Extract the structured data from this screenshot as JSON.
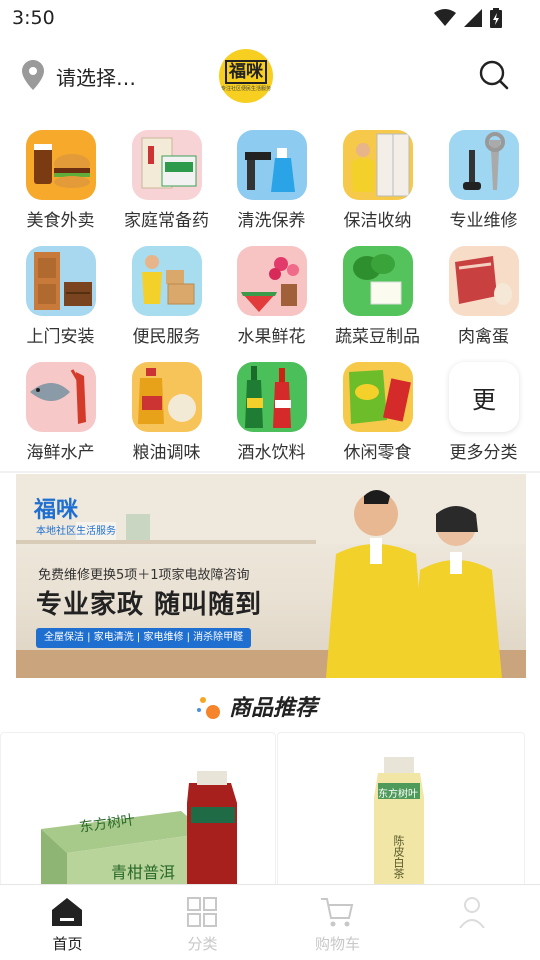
{
  "status_bar": {
    "time": "3:50"
  },
  "header": {
    "location": "请选择…",
    "logo_text": "福咪",
    "logo_subtext": "专注社区便民生活服务"
  },
  "categories": [
    {
      "label": "美食外卖",
      "icon": "burger-drink-icon"
    },
    {
      "label": "家庭常备药",
      "icon": "medicine-box-icon"
    },
    {
      "label": "清洗保养",
      "icon": "spray-bottle-icon"
    },
    {
      "label": "保洁收纳",
      "icon": "cleaner-wardrobe-icon"
    },
    {
      "label": "专业维修",
      "icon": "wrench-icon"
    },
    {
      "label": "上门安装",
      "icon": "door-cabinet-icon"
    },
    {
      "label": "便民服务",
      "icon": "delivery-boxes-icon"
    },
    {
      "label": "水果鲜花",
      "icon": "fruit-flower-icon"
    },
    {
      "label": "蔬菜豆制品",
      "icon": "vegetable-tofu-icon"
    },
    {
      "label": "肉禽蛋",
      "icon": "meat-egg-icon"
    },
    {
      "label": "海鲜水产",
      "icon": "fish-lobster-icon"
    },
    {
      "label": "粮油调味",
      "icon": "oil-rice-icon"
    },
    {
      "label": "酒水饮料",
      "icon": "bottles-icon"
    },
    {
      "label": "休闲零食",
      "icon": "snack-bag-icon"
    },
    {
      "label": "更多分类",
      "icon": "more-icon",
      "glyph": "更"
    }
  ],
  "banner": {
    "brand": "福咪",
    "brand_sub": "本地社区生活服务",
    "promo": "免费维修更换5项＋1项家电故障咨询",
    "headline": "专业家政 随叫随到",
    "tags": "全屋保洁 | 家电清洗 | 家电维修 | 消杀除甲醛"
  },
  "section": {
    "title": "商品推荐"
  },
  "products": [
    {
      "brand": "东方树叶",
      "flavor": "青柑普洱"
    },
    {
      "brand": "东方树叶",
      "flavor": "陈皮白茶"
    }
  ],
  "bottom_nav": [
    {
      "label": "首页",
      "active": true
    },
    {
      "label": "分类",
      "active": false
    },
    {
      "label": "购物车",
      "active": false
    },
    {
      "label": "",
      "active": false
    }
  ],
  "colors": {
    "brand_yellow": "#f6cf21",
    "brand_blue": "#1f6fd0",
    "active": "#222222",
    "inactive": "#c8c8c8"
  }
}
